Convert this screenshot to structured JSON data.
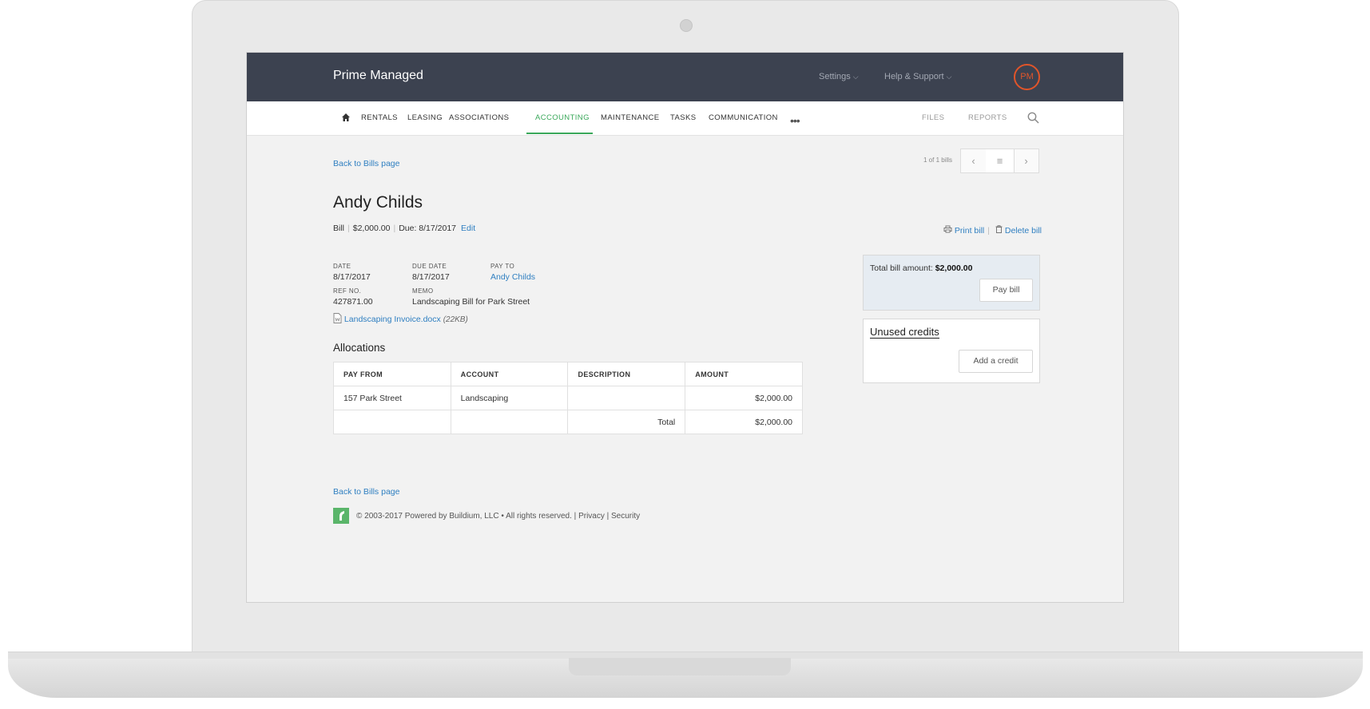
{
  "app": {
    "brand": "Prime Managed",
    "settings_label": "Settings",
    "help_label": "Help & Support",
    "avatar_initials": "PM",
    "colors": {
      "topbar": "#3c4250",
      "accent_green": "#3aa85a",
      "link_blue": "#2f7fc1",
      "avatar_orange": "#e0552a"
    }
  },
  "nav": {
    "items": [
      "RENTALS",
      "LEASING",
      "ASSOCIATIONS",
      "ACCOUNTING",
      "MAINTENANCE",
      "TASKS",
      "COMMUNICATION"
    ],
    "active": "ACCOUNTING",
    "right_items": [
      "FILES",
      "REPORTS"
    ],
    "icons": [
      "home-icon",
      "more-icon",
      "search-icon"
    ]
  },
  "bill": {
    "back_link": "Back to Bills page",
    "pager_text": "1 of 1 bills",
    "title": "Andy Childs",
    "type": "Bill",
    "amount": "$2,000.00",
    "due_text": "Due: 8/17/2017",
    "edit_label": "Edit",
    "print_label": "Print bill",
    "delete_label": "Delete bill",
    "date_label": "DATE",
    "date_value": "8/17/2017",
    "due_date_label": "DUE DATE",
    "due_date_value": "8/17/2017",
    "pay_to_label": "PAY TO",
    "pay_to_value": "Andy Childs",
    "ref_label": "REF NO.",
    "ref_value": "427871.00",
    "memo_label": "MEMO",
    "memo_value": "Landscaping Bill for Park Street",
    "attachment_name": "Landscaping Invoice.docx",
    "attachment_size": "(22KB)"
  },
  "allocations": {
    "title": "Allocations",
    "headers": [
      "PAY FROM",
      "ACCOUNT",
      "DESCRIPTION",
      "AMOUNT"
    ],
    "rows": [
      [
        "157 Park Street",
        "Landscaping",
        "",
        "$2,000.00"
      ]
    ],
    "total_label": "Total",
    "total_value": "$2,000.00"
  },
  "sidebar": {
    "total_label": "Total bill amount:",
    "total_value": "$2,000.00",
    "pay_button": "Pay bill",
    "credits_title": "Unused credits",
    "add_credit_button": "Add a credit"
  },
  "footer": {
    "back_link": "Back to Bills page",
    "copyright": "© 2003-2017 Powered by Buildium, LLC • All rights reserved.",
    "privacy": "Privacy",
    "security": "Security"
  }
}
